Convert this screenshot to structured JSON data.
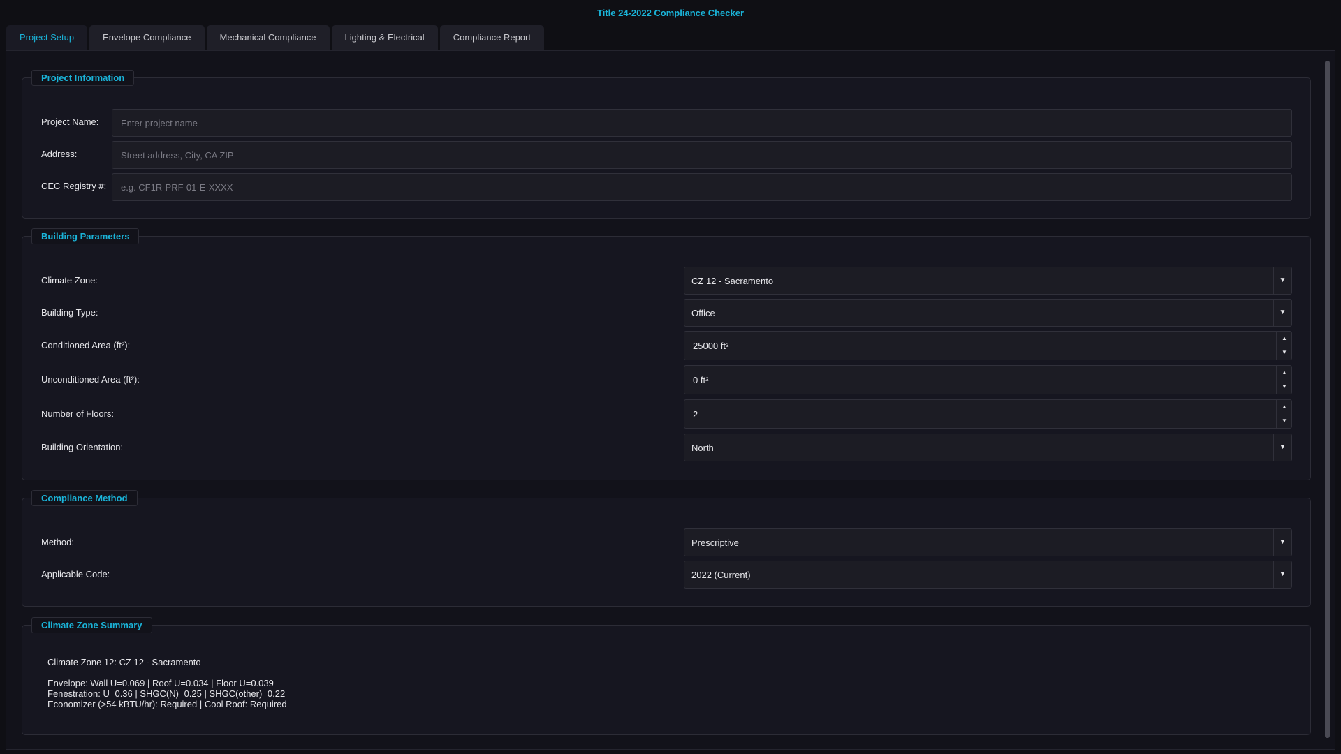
{
  "app": {
    "title": "Title 24-2022 Compliance Checker"
  },
  "tabs": [
    {
      "label": "Project Setup",
      "active": true
    },
    {
      "label": "Envelope Compliance",
      "active": false
    },
    {
      "label": "Mechanical Compliance",
      "active": false
    },
    {
      "label": "Lighting & Electrical",
      "active": false
    },
    {
      "label": "Compliance Report",
      "active": false
    }
  ],
  "project_info": {
    "title": "Project Information",
    "name_label": "Project Name:",
    "name_placeholder": "Enter project name",
    "name_value": "",
    "address_label": "Address:",
    "address_placeholder": "Street address, City, CA ZIP",
    "address_value": "",
    "registry_label": "CEC Registry #:",
    "registry_placeholder": "e.g. CF1R-PRF-01-E-XXXX",
    "registry_value": ""
  },
  "building_params": {
    "title": "Building Parameters",
    "climate_zone_label": "Climate Zone:",
    "climate_zone_value": "CZ 12 - Sacramento",
    "building_type_label": "Building Type:",
    "building_type_value": "Office",
    "conditioned_area_label": "Conditioned Area (ft²):",
    "conditioned_area_value": "25000 ft²",
    "unconditioned_area_label": "Unconditioned Area (ft²):",
    "unconditioned_area_value": "0 ft²",
    "floors_label": "Number of Floors:",
    "floors_value": "2",
    "orientation_label": "Building Orientation:",
    "orientation_value": "North"
  },
  "compliance_method": {
    "title": "Compliance Method",
    "method_label": "Method:",
    "method_value": "Prescriptive",
    "code_label": "Applicable Code:",
    "code_value": "2022 (Current)"
  },
  "climate_summary": {
    "title": "Climate Zone Summary",
    "heading": "Climate Zone 12: CZ 12 - Sacramento",
    "envelope_line": "Envelope:  Wall U=0.069  |  Roof U=0.034  |  Floor U=0.039",
    "fenestration_line": "Fenestration:  U=0.36  |  SHGC(N)=0.25  |  SHGC(other)=0.22",
    "economizer_line": "Economizer (>54 kBTU/hr): Required  |  Cool Roof: Required"
  },
  "icons": {
    "dropdown_arrow": "▼",
    "spin_up": "▲",
    "spin_down": "▼"
  },
  "colors": {
    "accent": "#1ab3d8",
    "background": "#0f0f14",
    "panel": "#12121a",
    "text": "#e6e6ea"
  }
}
